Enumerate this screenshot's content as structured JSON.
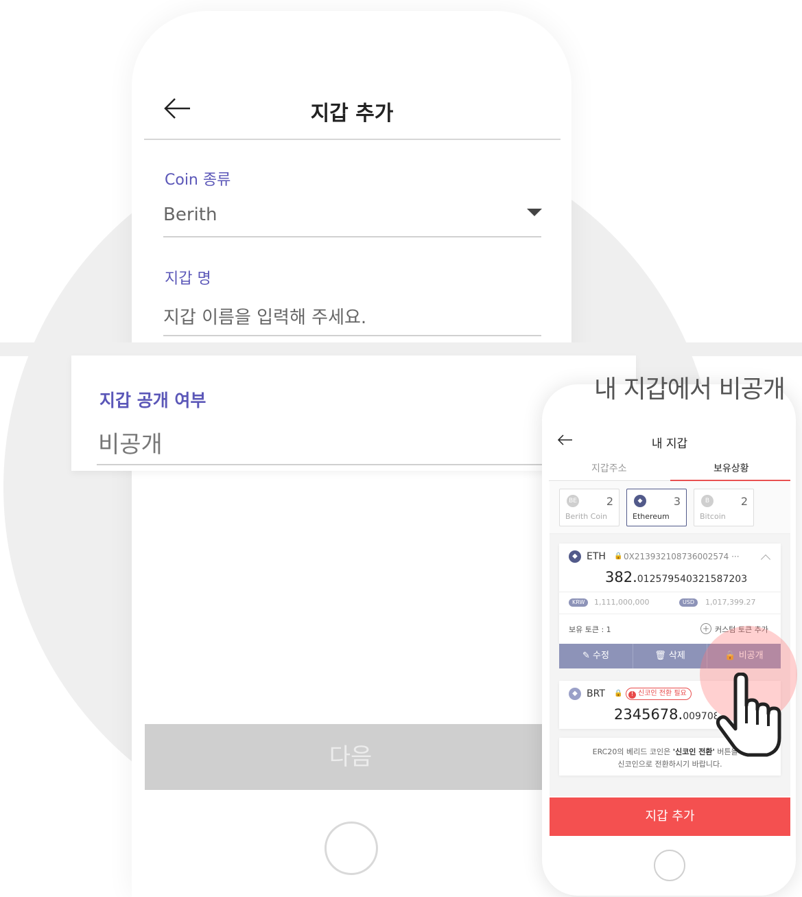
{
  "left_screen": {
    "title": "지갑 추가",
    "coin_type": {
      "label": "Coin 종류",
      "value": "Berith"
    },
    "wallet_name": {
      "label": "지갑 명",
      "placeholder": "지갑 이름을 입력해 주세요."
    },
    "next_button": "다음"
  },
  "overlay": {
    "label": "지갑 공개 여부",
    "value": "비공개"
  },
  "caption": "내 지갑에서 비공개",
  "right_screen": {
    "title": "내 지갑",
    "tabs": [
      {
        "label": "지갑주소",
        "active": false
      },
      {
        "label": "보유상황",
        "active": true
      }
    ],
    "coins": [
      {
        "icon": "berith-coin-icon",
        "glyph": "BE",
        "count": "2",
        "name": "Berith Coin"
      },
      {
        "icon": "ethereum-icon",
        "glyph": "◆",
        "count": "3",
        "name": "Ethereum"
      },
      {
        "icon": "bitcoin-icon",
        "glyph": "B",
        "count": "2",
        "name": "Bitcoin"
      }
    ],
    "eth_card": {
      "symbol": "ETH",
      "address": "0X213932108736002574 ···",
      "amount_int": "382.",
      "amount_dec": "012579540321587203",
      "krw_label": "KRW",
      "krw_value": "1,111,000,000",
      "usd_label": "USD",
      "usd_value": "1,017,399.27",
      "holding_tokens": "보유 토큰 : 1",
      "custom_token": "커스텀 토큰 추가",
      "actions": [
        "수정",
        "삭제",
        "비공개"
      ]
    },
    "brt_card": {
      "symbol": "BRT",
      "badge": "신코인 전환 필요",
      "amount_int": "2345678.",
      "amount_dec": "0097082"
    },
    "notice": {
      "line1_prefix": "ERC20의 베리드 코인은 ",
      "line1_bold": "'신코인 전환'",
      "line1_suffix": " 버튼을 통",
      "line2": "신코인으로 전환하시기 바랍니다."
    },
    "add_wallet_button": "지갑 추가"
  },
  "colors": {
    "accent_purple": "#5b57b8",
    "action_bar": "#8d93b8",
    "red": "#f45050",
    "eth_icon": "#525a8a"
  }
}
